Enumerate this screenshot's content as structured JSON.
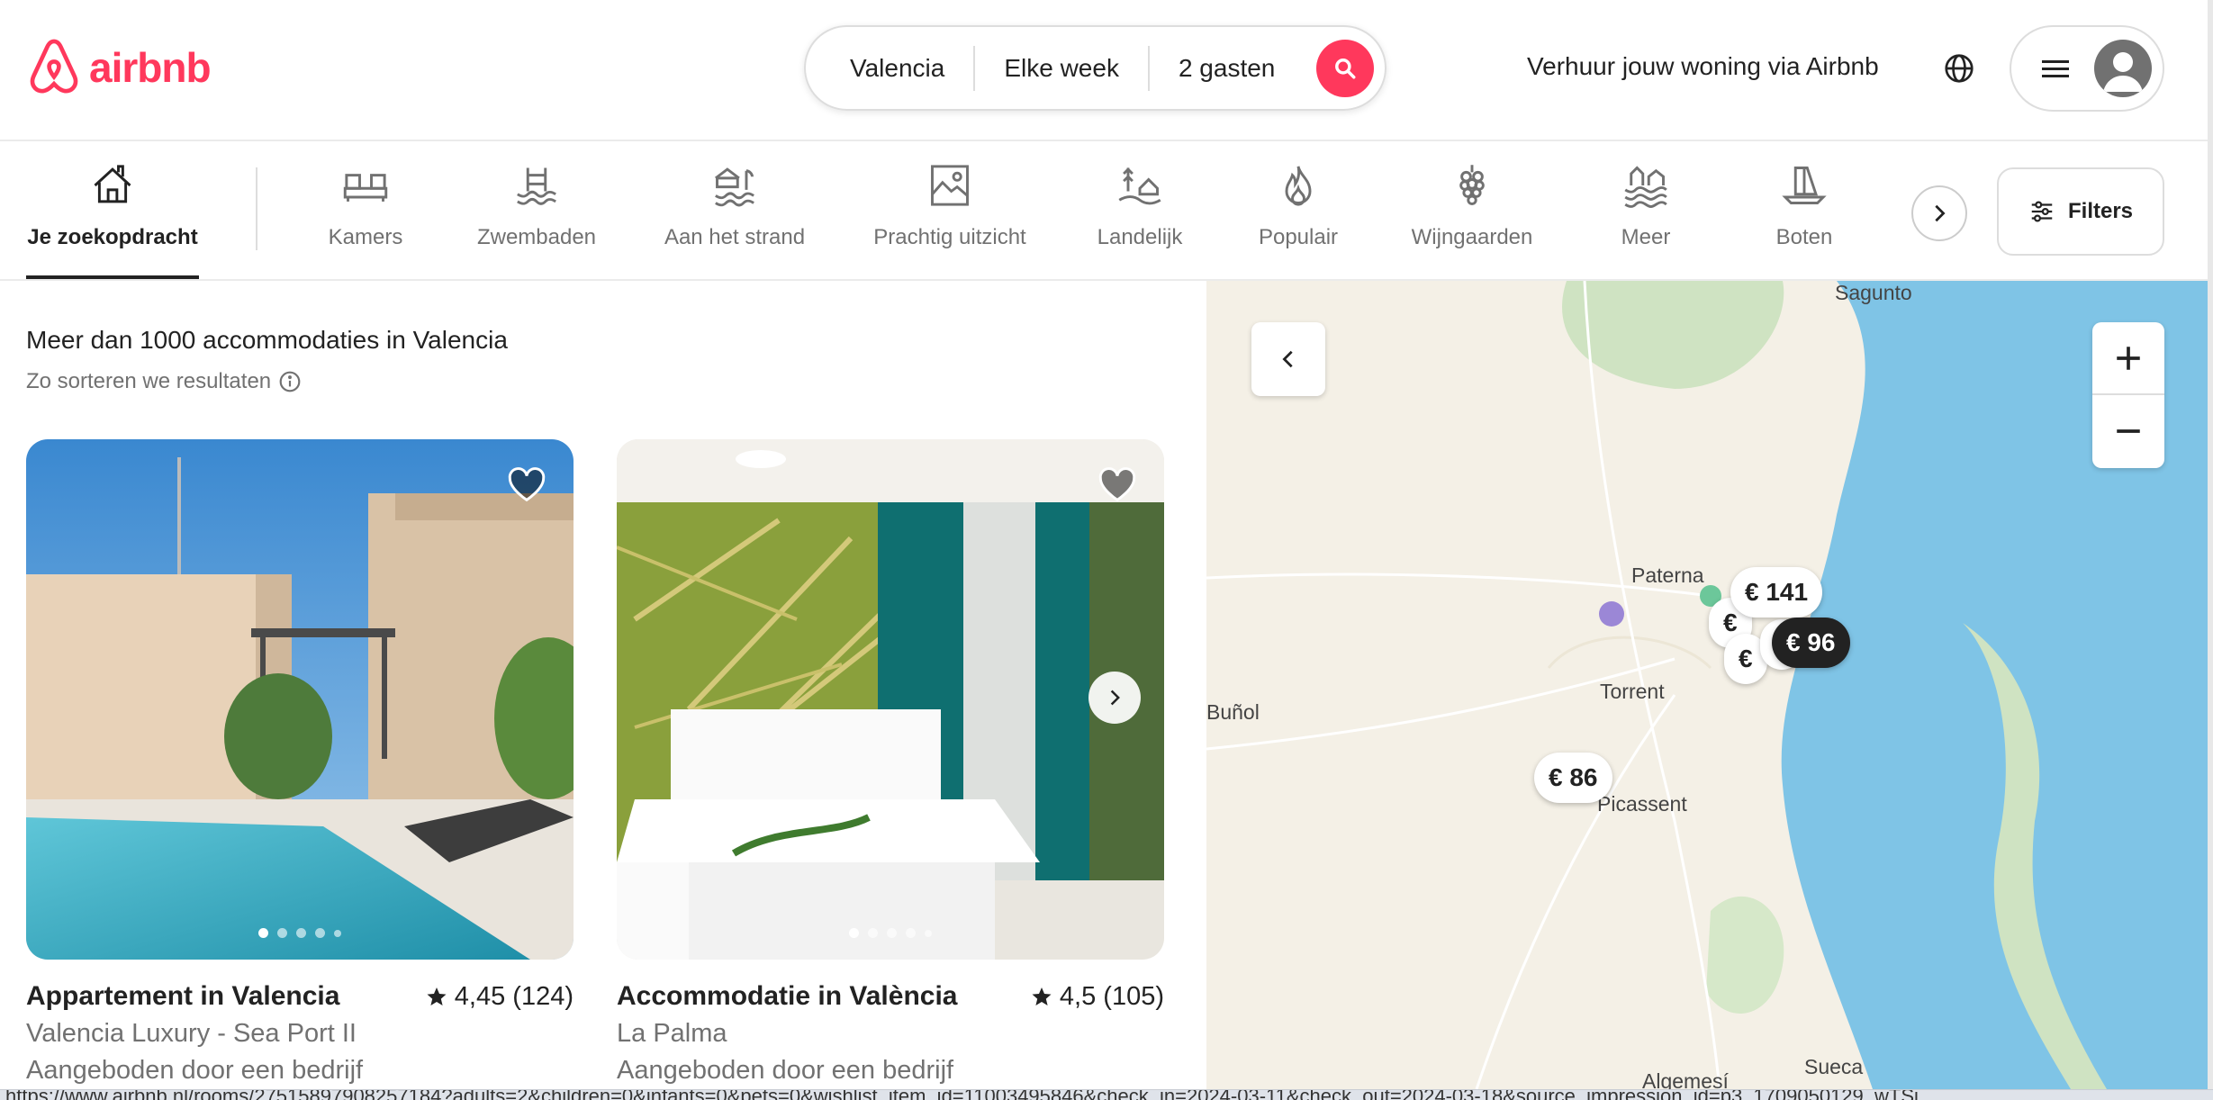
{
  "header": {
    "logo_text": "airbnb",
    "search": {
      "location": "Valencia",
      "dates": "Elke week",
      "guests": "2 gasten"
    },
    "host_link": "Verhuur jouw woning via Airbnb",
    "colors": {
      "brand": "#ff385c"
    }
  },
  "categories": [
    {
      "label": "Je zoekopdracht",
      "icon": "home-search-icon",
      "active": true
    },
    {
      "label": "Kamers",
      "icon": "bed-icon"
    },
    {
      "label": "Zwembaden",
      "icon": "pool-icon"
    },
    {
      "label": "Aan het strand",
      "icon": "beach-icon"
    },
    {
      "label": "Prachtig uitzicht",
      "icon": "view-icon"
    },
    {
      "label": "Landelijk",
      "icon": "countryside-icon"
    },
    {
      "label": "Populair",
      "icon": "flame-icon"
    },
    {
      "label": "Wijngaarden",
      "icon": "grapes-icon"
    },
    {
      "label": "Meer",
      "icon": "lake-icon"
    },
    {
      "label": "Boten",
      "icon": "boat-icon"
    }
  ],
  "filters_label": "Filters",
  "results": {
    "title": "Meer dan 1000 accommodaties in Valencia",
    "sort_info": "Zo sorteren we resultaten"
  },
  "listings": [
    {
      "title": "Appartement in Valencia",
      "rating": "4,45 (124)",
      "subtitle": "Valencia Luxury - Sea Port II",
      "host": "Aangeboden door een bedrijf",
      "photo_count": 5,
      "active_photo": 1
    },
    {
      "title": "Accommodatie in València",
      "rating": "4,5 (105)",
      "subtitle": "La Palma",
      "host": "Aangeboden door een bedrijf",
      "photo_count": 5,
      "active_photo": 1
    }
  ],
  "map": {
    "towns": [
      "Sagunto",
      "Paterna",
      "Torrent",
      "Buñol",
      "Picassent",
      "Algemesí",
      "Sueca"
    ],
    "prices": [
      "€ 141",
      "€ 96",
      "€ 86"
    ],
    "partial_pins": [
      "€",
      "€",
      "€"
    ]
  },
  "status_url": "https://www.airbnb.nl/rooms/27515897908257184?adults=2&children=0&infants=0&pets=0&wishlist_item_id=11003495846&check_in=2024-03-11&check_out=2024-03-18&source_impression_id=p3_1709050129_wTSj"
}
